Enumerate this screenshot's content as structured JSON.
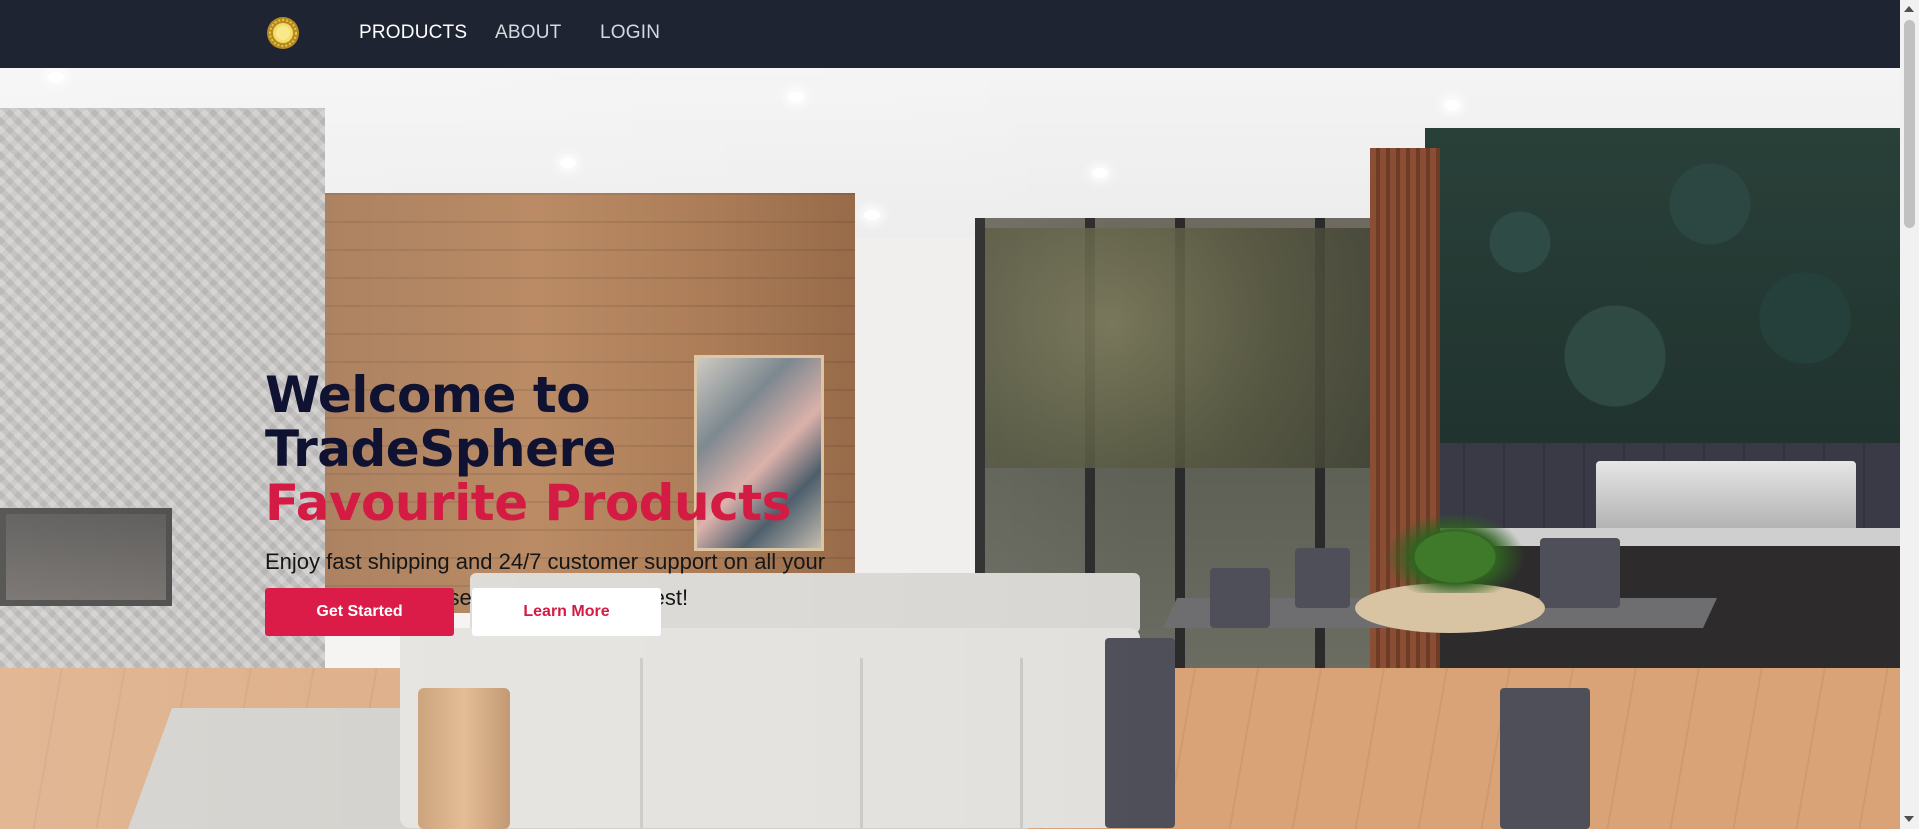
{
  "navbar": {
    "logo_icon": "golden-sun-emblem",
    "links": [
      {
        "label": "PRODUCTS",
        "active": true
      },
      {
        "label": "ABOUT",
        "active": false
      },
      {
        "label": "LOGIN",
        "active": false
      }
    ]
  },
  "hero": {
    "title_line1": "Welcome to",
    "title_line2": "TradeSphere",
    "title_line3": "Favourite Products",
    "subtitle": "Enjoy fast shipping and 24/7 customer support on all your purchases—because you deserve the best!",
    "primary_button": "Get Started",
    "secondary_button": "Learn More",
    "background": "modern living room with open glass doors to outdoor kitchen and dining table"
  },
  "colors": {
    "navbar_bg": "#1f2433",
    "title_dark": "#0f1230",
    "accent": "#d41b44",
    "button_primary_bg": "#dc1c48"
  }
}
